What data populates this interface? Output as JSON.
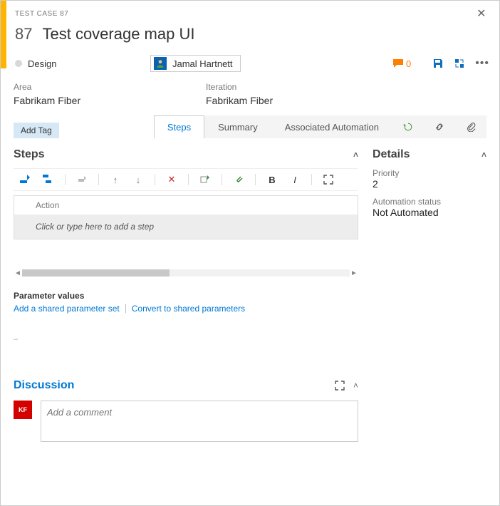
{
  "header": {
    "type_label": "TEST CASE 87",
    "id": "87",
    "title": "Test coverage map UI"
  },
  "meta": {
    "state": "Design",
    "assignee": "Jamal Hartnett",
    "comment_count": "0"
  },
  "fields": {
    "area_label": "Area",
    "area_value": "Fabrikam Fiber",
    "iteration_label": "Iteration",
    "iteration_value": "Fabrikam Fiber"
  },
  "add_tag_label": "Add Tag",
  "tabs": {
    "steps": "Steps",
    "summary": "Summary",
    "automation": "Associated Automation"
  },
  "steps": {
    "section_title": "Steps",
    "column_action": "Action",
    "placeholder": "Click or type here to add a step"
  },
  "params": {
    "heading": "Parameter values",
    "add_shared": "Add a shared parameter set",
    "convert": "Convert to shared parameters"
  },
  "details": {
    "section_title": "Details",
    "priority_label": "Priority",
    "priority_value": "2",
    "automation_label": "Automation status",
    "automation_value": "Not Automated"
  },
  "discussion": {
    "title": "Discussion",
    "avatar_initials": "KF",
    "placeholder": "Add a comment"
  }
}
